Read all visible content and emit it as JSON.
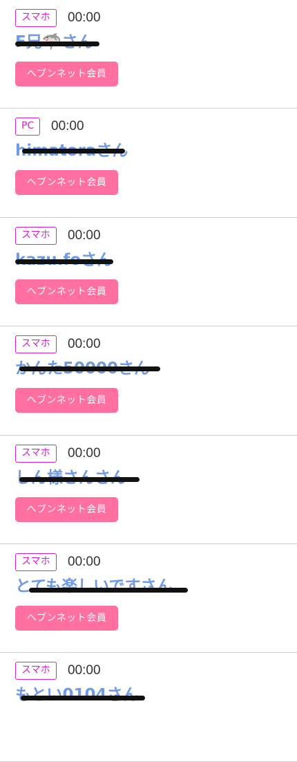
{
  "entries": [
    {
      "device": "スマホ",
      "time": "00:00",
      "name": "F兄🦈さん",
      "member_label": "ヘブンネット会員"
    },
    {
      "device": "PC",
      "time": "00:00",
      "name": "himatoraさん",
      "member_label": "ヘブンネット会員"
    },
    {
      "device": "スマホ",
      "time": "00:00",
      "name": "kazu.foさん",
      "member_label": "ヘブンネット会員"
    },
    {
      "device": "スマホ",
      "time": "00:00",
      "name": "かんた50000さん",
      "member_label": "ヘブンネット会員"
    },
    {
      "device": "スマホ",
      "time": "00:00",
      "name": "しん様さんさん",
      "member_label": "ヘブンネット会員"
    },
    {
      "device": "スマホ",
      "time": "00:00",
      "name": "とても楽しいですさん",
      "member_label": "ヘブンネット会員"
    },
    {
      "device": "スマホ",
      "time": "00:00",
      "name": "もとい0104さん"
    }
  ]
}
